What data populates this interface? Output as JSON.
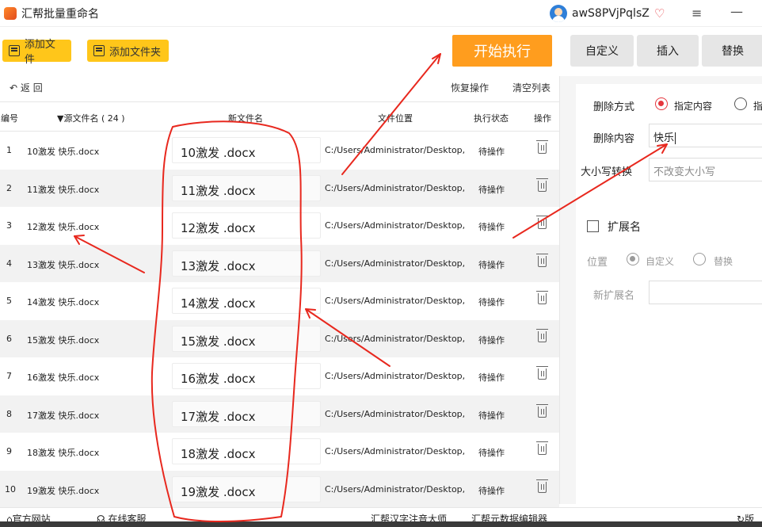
{
  "title": {
    "app_name": "汇帮批量重命名",
    "username": "awS8PVjPqlsZ",
    "vip_icon": "heart-diamond-icon",
    "menu_icon": "≡",
    "minimize_icon": "—"
  },
  "toolbar": {
    "add_file": "添加文件",
    "add_folder": "添加文件夹",
    "start": "开始执行",
    "tabs": [
      "自定义",
      "插入",
      "替换"
    ]
  },
  "list": {
    "back": "返 回",
    "restore": "恢复操作",
    "clear": "清空列表",
    "headers": {
      "index": "编号",
      "source": "▼源文件名 ( 24 )",
      "new_name": "新文件名",
      "location": "文件位置",
      "status": "执行状态",
      "action": "操作"
    },
    "rows": [
      {
        "index": "1",
        "source": "10激发 快乐.docx",
        "new_name": "10激发 .docx",
        "location": "C:/Users/Administrator/Desktop,",
        "status": "待操作"
      },
      {
        "index": "2",
        "source": "11激发 快乐.docx",
        "new_name": "11激发 .docx",
        "location": "C:/Users/Administrator/Desktop,",
        "status": "待操作"
      },
      {
        "index": "3",
        "source": "12激发 快乐.docx",
        "new_name": "12激发 .docx",
        "location": "C:/Users/Administrator/Desktop,",
        "status": "待操作"
      },
      {
        "index": "4",
        "source": "13激发 快乐.docx",
        "new_name": "13激发 .docx",
        "location": "C:/Users/Administrator/Desktop,",
        "status": "待操作"
      },
      {
        "index": "5",
        "source": "14激发 快乐.docx",
        "new_name": "14激发 .docx",
        "location": "C:/Users/Administrator/Desktop,",
        "status": "待操作"
      },
      {
        "index": "6",
        "source": "15激发 快乐.docx",
        "new_name": "15激发 .docx",
        "location": "C:/Users/Administrator/Desktop,",
        "status": "待操作"
      },
      {
        "index": "7",
        "source": "16激发 快乐.docx",
        "new_name": "16激发 .docx",
        "location": "C:/Users/Administrator/Desktop,",
        "status": "待操作"
      },
      {
        "index": "8",
        "source": "17激发 快乐.docx",
        "new_name": "17激发 .docx",
        "location": "C:/Users/Administrator/Desktop,",
        "status": "待操作"
      },
      {
        "index": "9",
        "source": "18激发 快乐.docx",
        "new_name": "18激发 .docx",
        "location": "C:/Users/Administrator/Desktop,",
        "status": "待操作"
      },
      {
        "index": "10",
        "source": "19激发 快乐.docx",
        "new_name": "19激发 .docx",
        "location": "C:/Users/Administrator/Desktop,",
        "status": "待操作"
      }
    ]
  },
  "side": {
    "delete_mode_label": "删除方式",
    "option_specified": "指定内容",
    "option_other": "指",
    "delete_content_label": "删除内容",
    "delete_content_value": "快乐",
    "case_label": "大小写转换",
    "case_value": "不改变大小写",
    "ext_label": "扩展名",
    "position_label": "位置",
    "pos_custom": "自定义",
    "pos_replace": "替换",
    "new_ext_label": "新扩展名",
    "new_ext_value": ""
  },
  "footer": {
    "website": "官方网站",
    "service": "在线客服",
    "app1": "汇帮汉字注音大师",
    "app2": "汇帮元数据编辑器",
    "version": "版"
  },
  "annotation_color": "#e8281e",
  "accent_color": "#ff9d1e",
  "button_color": "#ffc61a"
}
